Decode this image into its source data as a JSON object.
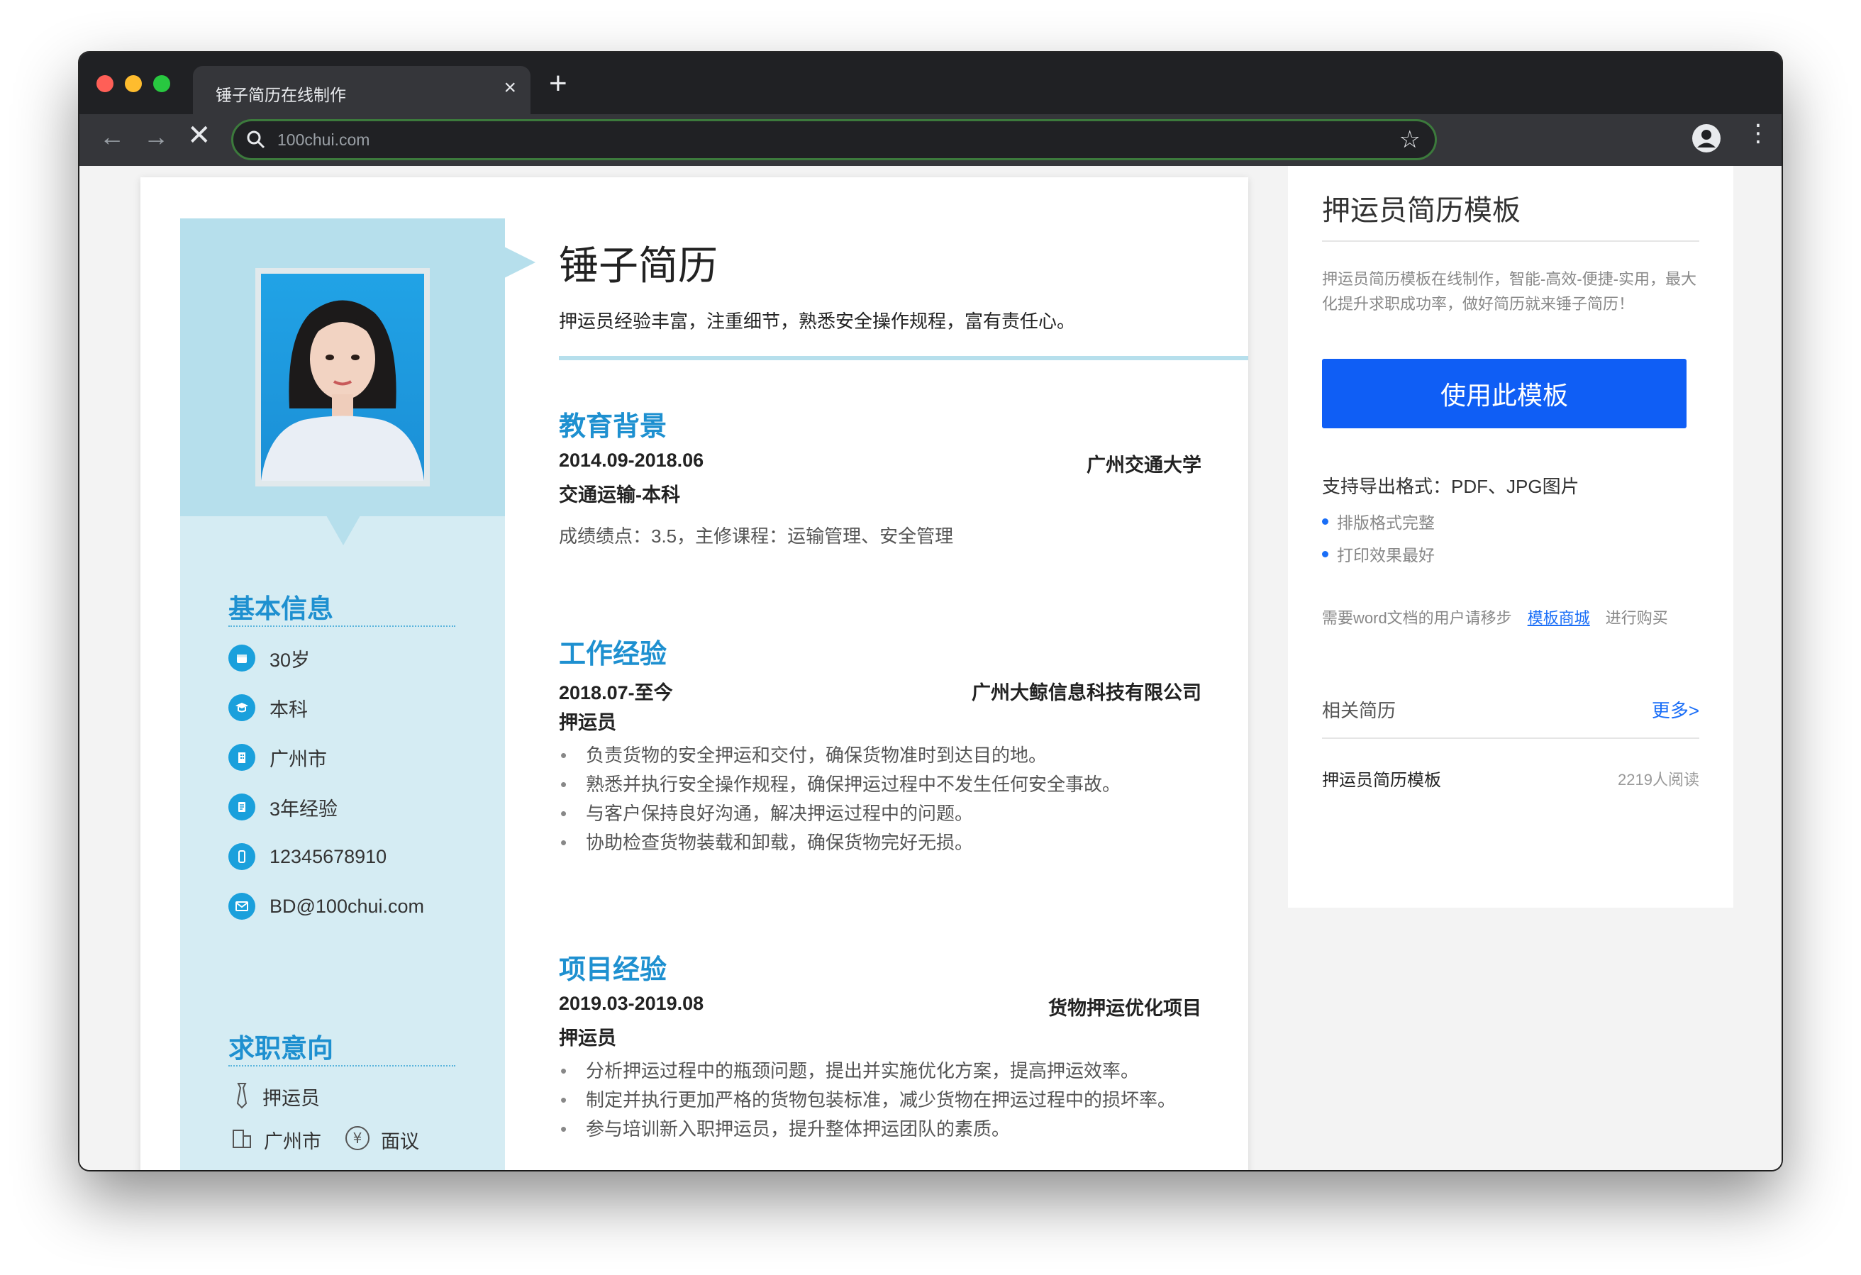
{
  "browser": {
    "tab_title": "锤子简历在线制作",
    "url": "100chui.com"
  },
  "resume": {
    "name": "锤子简历",
    "summary": "押运员经验丰富，注重细节，熟悉安全操作规程，富有责任心。",
    "basic_info": {
      "title": "基本信息",
      "items": [
        {
          "icon": "calendar-icon",
          "text": "30岁"
        },
        {
          "icon": "graduation-cap-icon",
          "text": "本科"
        },
        {
          "icon": "building-icon",
          "text": "广州市"
        },
        {
          "icon": "document-icon",
          "text": "3年经验"
        },
        {
          "icon": "phone-icon",
          "text": "12345678910"
        },
        {
          "icon": "mail-icon",
          "text": "BD@100chui.com"
        }
      ]
    },
    "job_intent": {
      "title": "求职意向",
      "position": "押运员",
      "city": "广州市",
      "salary": "面议"
    },
    "education": {
      "title": "教育背景",
      "date": "2014.09-2018.06",
      "school": "广州交通大学",
      "major": "交通运输-本科",
      "note": "成绩绩点：3.5，主修课程：运输管理、安全管理"
    },
    "work": {
      "title": "工作经验",
      "date": "2018.07-至今",
      "company": "广州大鲸信息科技有限公司",
      "role": "押运员",
      "bullets": [
        "负责货物的安全押运和交付，确保货物准时到达目的地。",
        "熟悉并执行安全操作规程，确保押运过程中不发生任何安全事故。",
        "与客户保持良好沟通，解决押运过程中的问题。",
        "协助检查货物装载和卸载，确保货物完好无损。"
      ]
    },
    "project": {
      "title": "项目经验",
      "date": "2019.03-2019.08",
      "name": "货物押运优化项目",
      "role": "押运员",
      "bullets": [
        "分析押运过程中的瓶颈问题，提出并实施优化方案，提高押运效率。",
        "制定并执行更加严格的货物包装标准，减少货物在押运过程中的损坏率。",
        "参与培训新入职押运员，提升整体押运团队的素质。"
      ]
    }
  },
  "panel": {
    "title": "押运员简历模板",
    "description": "押运员简历模板在线制作，智能-高效-便捷-实用，最大化提升求职成功率，做好简历就来锤子简历！",
    "use_button": "使用此模板",
    "export_formats": "支持导出格式：PDF、JPG图片",
    "features": [
      "排版格式完整",
      "打印效果最好"
    ],
    "word_note_prefix": "需要word文档的用户请移步",
    "word_note_link": "模板商城",
    "word_note_suffix": "进行购买",
    "related_title": "相关简历",
    "related_more": "更多>",
    "related_item": "押运员简历模板",
    "related_reads": "2219人阅读"
  },
  "colors": {
    "accent": "#1e90d0",
    "sidebar": "#d5ecf3",
    "photo_band": "#b6dfec",
    "button": "#0f5ef5"
  }
}
